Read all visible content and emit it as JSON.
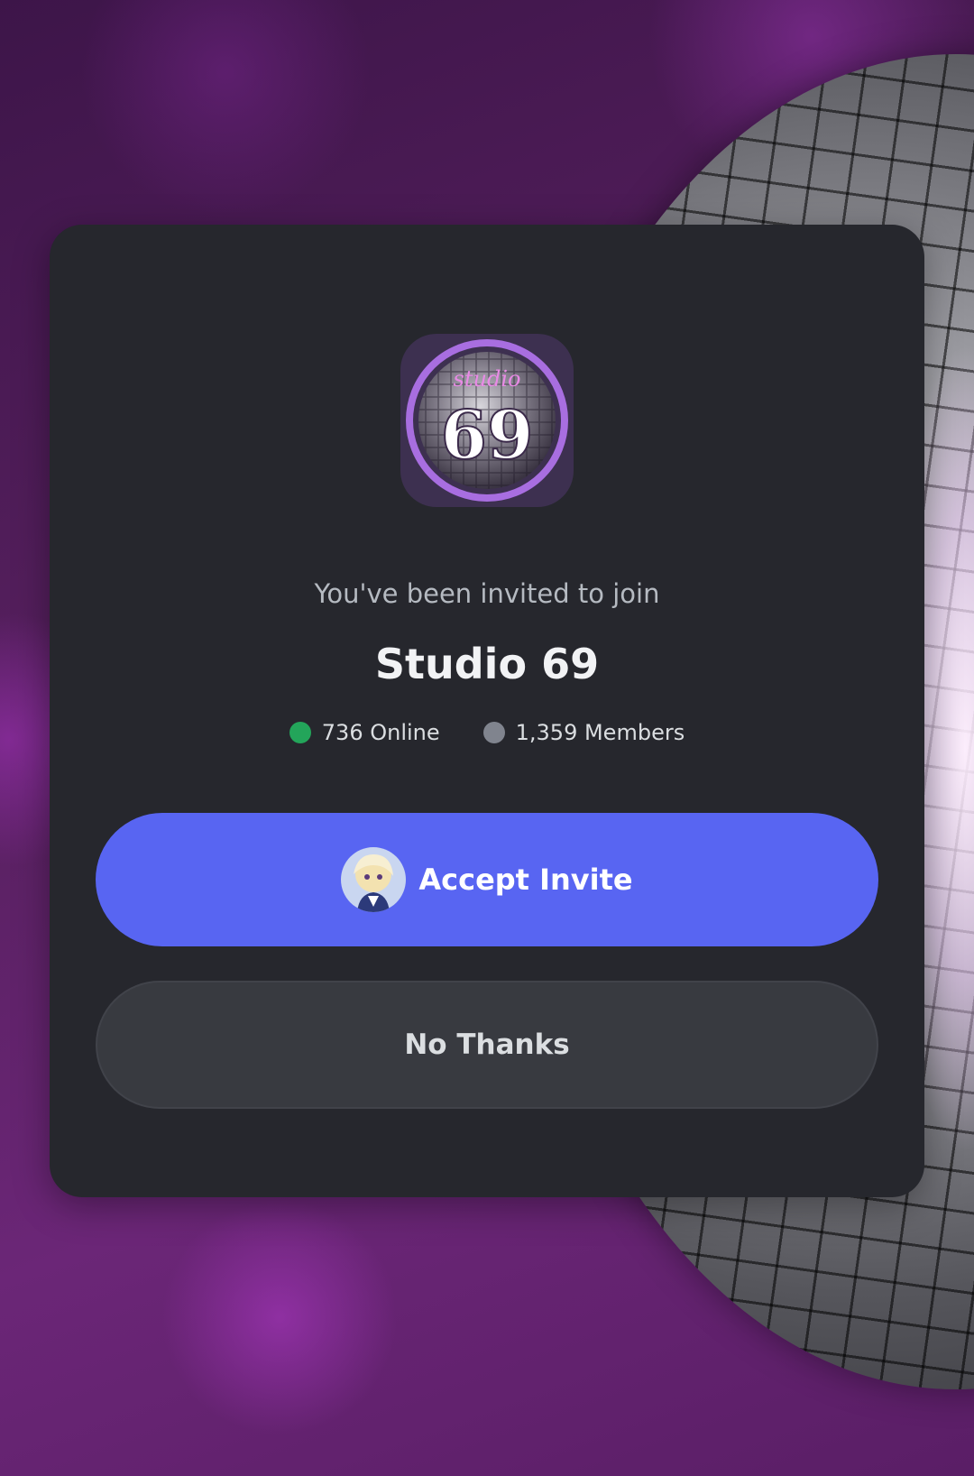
{
  "invite": {
    "intro_text": "You've been invited to join",
    "server_name": "Studio 69",
    "online_count": "736 Online",
    "member_count": "1,359 Members",
    "server_icon": {
      "top_text": "studio",
      "number_text": "69",
      "icon_name": "server-icon-studio-69"
    },
    "accept_button_label": "Accept Invite",
    "decline_button_label": "No Thanks"
  },
  "colors": {
    "card_bg": "#26272d",
    "accept_button": "#5865f2",
    "decline_button": "#383a40",
    "online_dot": "#23a55a",
    "members_dot": "#80848e",
    "icon_ring": "#a86ee0"
  }
}
